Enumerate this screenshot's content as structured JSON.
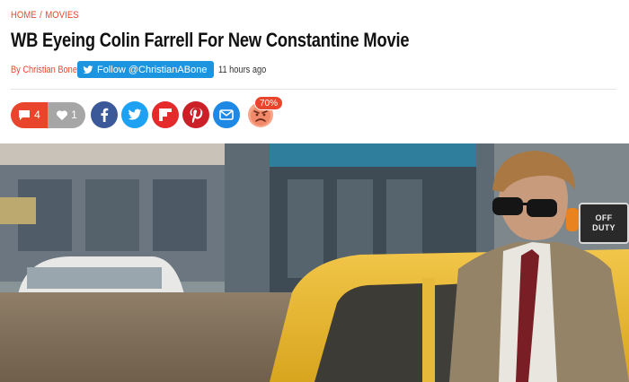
{
  "breadcrumb": {
    "home": "HOME",
    "separator": "/",
    "section": "MOVIES"
  },
  "article": {
    "title": "WB Eyeing Colin Farrell For New Constantine Movie",
    "byline": "By Christian Bone",
    "follow_label": "Follow @ChristianABone",
    "time": "11 hours ago"
  },
  "share": {
    "comments_count": "4",
    "likes_count": "1",
    "reaction_percent": "70%",
    "buttons": [
      "facebook-icon",
      "twitter-icon",
      "flipboard-icon",
      "pinterest-icon",
      "email-icon"
    ]
  },
  "hero": {
    "taxi_sign_line1": "OFF",
    "taxi_sign_line2": "DUTY"
  },
  "colors": {
    "accent": "#e8452c",
    "twitter": "#1b95e0",
    "facebook": "#3b5998",
    "flipboard": "#e42a2a",
    "pinterest": "#cb2027",
    "email": "#1e88e5",
    "likes": "#a6a6a6"
  }
}
